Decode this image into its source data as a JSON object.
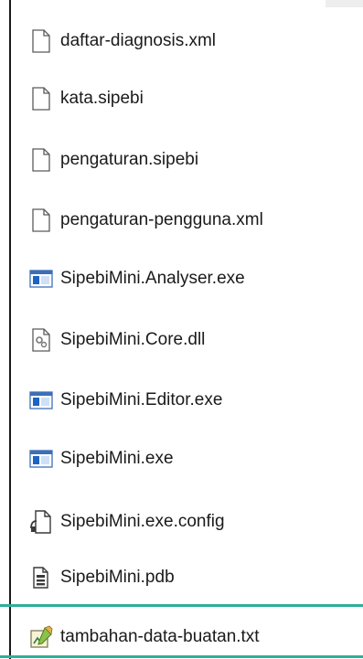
{
  "file_list": {
    "items": [
      {
        "label": "daftar-diagnosis.xml",
        "icon": "blank-file-icon"
      },
      {
        "label": "kata.sipebi",
        "icon": "blank-file-icon"
      },
      {
        "label": "pengaturan.sipebi",
        "icon": "blank-file-icon"
      },
      {
        "label": "pengaturan-pengguna.xml",
        "icon": "blank-file-icon"
      },
      {
        "label": "SipebiMini.Analyser.exe",
        "icon": "application-window-icon"
      },
      {
        "label": "SipebiMini.Core.dll",
        "icon": "dll-gear-file-icon"
      },
      {
        "label": "SipebiMini.Editor.exe",
        "icon": "application-window-icon"
      },
      {
        "label": "SipebiMini.exe",
        "icon": "application-window-icon"
      },
      {
        "label": "SipebiMini.exe.config",
        "icon": "config-file-icon"
      },
      {
        "label": "SipebiMini.pdb",
        "icon": "pdb-file-icon"
      },
      {
        "label": "tambahan-data-buatan.txt",
        "icon": "text-file-notepad-icon"
      }
    ]
  },
  "colors": {
    "highlight_line": "#2fae9a",
    "app_icon_blue": "#1e63c6"
  }
}
